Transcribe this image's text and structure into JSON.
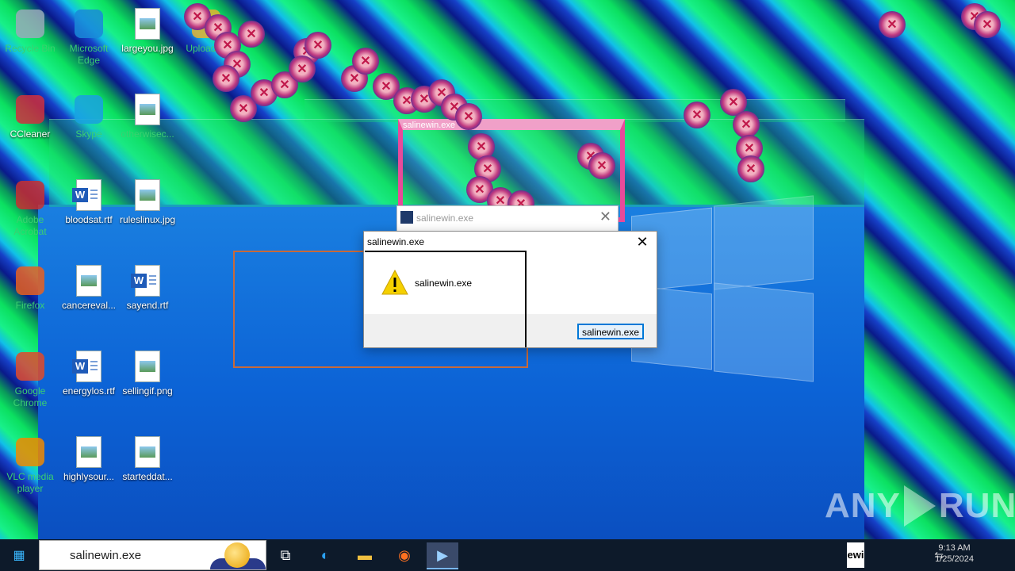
{
  "desktop": {
    "icons": [
      {
        "label": "Recycle Bin",
        "name": "recycle-bin-icon",
        "faded": true
      },
      {
        "label": "Microsoft Edge",
        "name": "edge-icon",
        "faded": true
      },
      {
        "label": "largeyou.jpg",
        "name": "image-file-icon",
        "faded": false
      },
      {
        "label": "Uploaded",
        "name": "upload-folder-icon",
        "faded": true
      },
      {
        "label": "CCleaner",
        "name": "ccleaner-icon",
        "faded": false
      },
      {
        "label": "Skype",
        "name": "skype-icon",
        "faded": true
      },
      {
        "label": "otherwisec...",
        "name": "image-file-icon",
        "faded": true
      },
      {
        "label": "Adobe Acrobat",
        "name": "acrobat-icon",
        "faded": true
      },
      {
        "label": "bloodsat.rtf",
        "name": "word-doc-icon",
        "faded": false
      },
      {
        "label": "ruleslinux.jpg",
        "name": "image-file-icon",
        "faded": false
      },
      {
        "label": "Firefox",
        "name": "firefox-icon",
        "faded": true
      },
      {
        "label": "cancereval...",
        "name": "image-file-icon",
        "faded": false
      },
      {
        "label": "sayend.rtf",
        "name": "word-doc-icon",
        "faded": false
      },
      {
        "label": "Google Chrome",
        "name": "chrome-icon",
        "faded": true
      },
      {
        "label": "energylos.rtf",
        "name": "word-doc-icon",
        "faded": false
      },
      {
        "label": "sellingif.png",
        "name": "image-file-icon",
        "faded": false
      },
      {
        "label": "VLC media player",
        "name": "vlc-icon",
        "faded": true
      },
      {
        "label": "highlysour...",
        "name": "image-file-icon",
        "faded": false
      },
      {
        "label": "starteddat...",
        "name": "image-file-icon",
        "faded": false
      }
    ]
  },
  "ghost_window": {
    "title": "salinewin.exe"
  },
  "background_window": {
    "title": "salinewin.exe",
    "close_glyph": "✕"
  },
  "dialog": {
    "title": "salinewin.exe",
    "close_glyph": "✕",
    "message": "salinewin.exe",
    "button_label": "salinewin.exe"
  },
  "watermark": {
    "left": "ANY",
    "right": "RUN"
  },
  "taskbar": {
    "search_text": "salinewin.exe",
    "overlay_text": "ewi",
    "items": [
      {
        "name": "task-view-icon",
        "glyph": "⧉"
      },
      {
        "name": "edge-taskbar-icon",
        "glyph": "◐"
      },
      {
        "name": "file-explorer-icon",
        "glyph": "▬"
      },
      {
        "name": "firefox-taskbar-icon",
        "glyph": "◉"
      },
      {
        "name": "salinewin-taskbar-icon",
        "glyph": "▶"
      }
    ],
    "clock_time": "9:13 AM",
    "clock_date": "1/25/2024"
  },
  "colors": {
    "accent": "#0078d7",
    "glitch_pink": "#e84a9a"
  }
}
